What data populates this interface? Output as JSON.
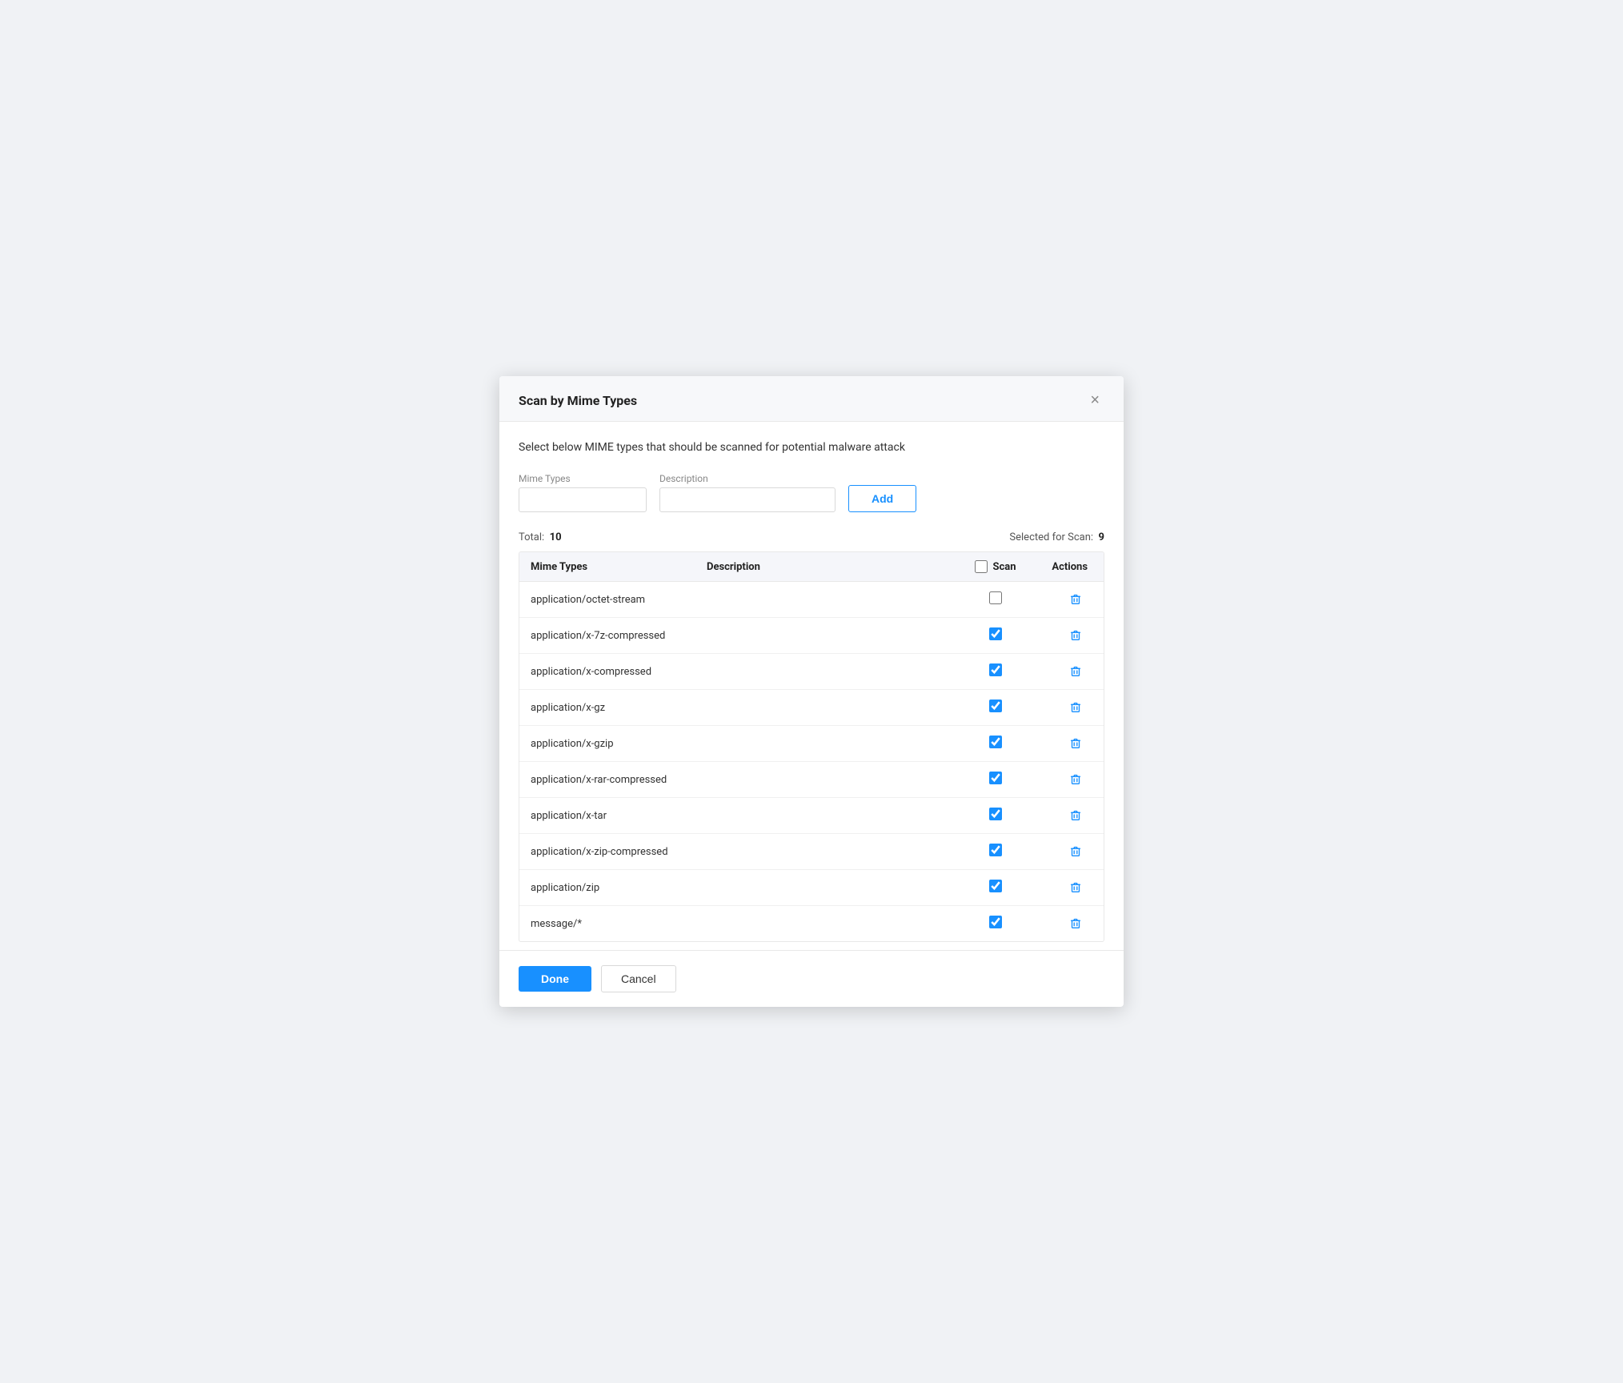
{
  "dialog": {
    "title": "Scan by Mime Types",
    "close_label": "×",
    "subtitle": "Select below MIME types that should be scanned for potential malware attack"
  },
  "form": {
    "mime_types_label": "Mime Types",
    "mime_types_placeholder": "",
    "description_label": "Description",
    "description_placeholder": "",
    "add_button_label": "Add"
  },
  "summary": {
    "total_label": "Total:",
    "total_value": "10",
    "selected_label": "Selected for Scan:",
    "selected_value": "9"
  },
  "table": {
    "col_mime": "Mime Types",
    "col_description": "Description",
    "col_scan": "Scan",
    "col_actions": "Actions",
    "header_checkbox_checked": false,
    "rows": [
      {
        "mime": "application/octet-stream",
        "description": "",
        "scan": false
      },
      {
        "mime": "application/x-7z-compressed",
        "description": "",
        "scan": true
      },
      {
        "mime": "application/x-compressed",
        "description": "",
        "scan": true
      },
      {
        "mime": "application/x-gz",
        "description": "",
        "scan": true
      },
      {
        "mime": "application/x-gzip",
        "description": "",
        "scan": true
      },
      {
        "mime": "application/x-rar-compressed",
        "description": "",
        "scan": true
      },
      {
        "mime": "application/x-tar",
        "description": "",
        "scan": true
      },
      {
        "mime": "application/x-zip-compressed",
        "description": "",
        "scan": true
      },
      {
        "mime": "application/zip",
        "description": "",
        "scan": true
      },
      {
        "mime": "message/*",
        "description": "",
        "scan": true
      }
    ]
  },
  "footer": {
    "done_label": "Done",
    "cancel_label": "Cancel"
  }
}
